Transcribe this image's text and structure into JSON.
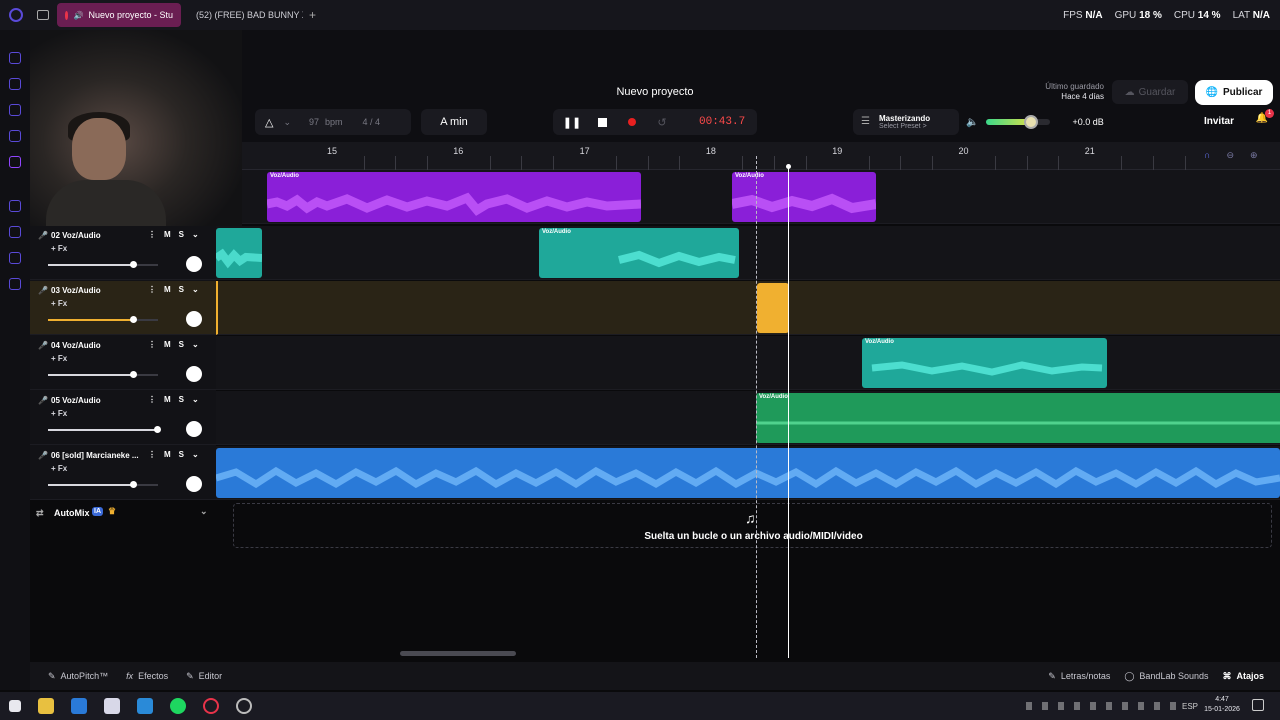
{
  "browser": {
    "tabs": [
      {
        "label": "Nuevo proyecto - Stu",
        "active": true
      },
      {
        "label": "(52) (FREE) BAD BUNNY X",
        "active": false
      }
    ],
    "new_tab": "+",
    "stats": {
      "fps_label": "FPS",
      "fps_value": "N/A",
      "gpu_label": "GPU",
      "gpu_value": "18 %",
      "cpu_label": "CPU",
      "cpu_value": "14 %",
      "lat_label": "LAT",
      "lat_value": "N/A"
    },
    "extension_hint": "dio",
    "ai_label": "AI"
  },
  "header": {
    "project_title": "Nuevo proyecto",
    "bpm": "97",
    "bpm_unit": "bpm",
    "time_signature": "4 / 4",
    "key": "A min",
    "time_display": "00:43.7",
    "master_title": "Masterizando",
    "master_preset": "Select Preset >",
    "volume_db": "+0.0 dB",
    "volume_level": 0.7,
    "last_saved_label": "Último guardado",
    "last_saved_value": "Hace 4 días",
    "save_label": "Guardar",
    "publish_label": "Publicar",
    "invite_label": "Invitar",
    "notification_count": "1"
  },
  "ruler": {
    "bars": [
      "15",
      "16",
      "17",
      "18",
      "19",
      "20",
      "21"
    ]
  },
  "tracks": [
    {
      "name": "02 Voz/Audio",
      "fx": "+ Fx",
      "mute": "M",
      "solo": "S",
      "fader": 0.78
    },
    {
      "name": "03 Voz/Audio",
      "fx": "+ Fx",
      "mute": "M",
      "solo": "S",
      "fader": 0.78
    },
    {
      "name": "04 Voz/Audio",
      "fx": "+ Fx",
      "mute": "M",
      "solo": "S",
      "fader": 0.78
    },
    {
      "name": "05 Voz/Audio",
      "fx": "+ Fx",
      "mute": "M",
      "solo": "S",
      "fader": 1.0
    },
    {
      "name": "06 [sold] Marcianeke ...",
      "fx": "+ Fx",
      "mute": "M",
      "solo": "S",
      "fader": 0.78
    }
  ],
  "clips": {
    "track1": [
      {
        "label": "Voz/Audio"
      },
      {
        "label": "Voz/Audio"
      }
    ],
    "track2": [
      {
        "label": "Voz/Audio"
      }
    ],
    "track4": [
      {
        "label": "Voz/Audio"
      }
    ],
    "track5": [
      {
        "label": "Voz/Audio"
      }
    ]
  },
  "automix": {
    "label": "AutoMix",
    "badge": "IA"
  },
  "dropzone": {
    "text": "Suelta un bucle o un archivo audio/MIDI/video"
  },
  "bottom_bar": {
    "autopitch": "AutoPitch™",
    "effects": "Efectos",
    "editor": "Editor",
    "lyrics": "Letras/notas",
    "sounds": "BandLab Sounds",
    "shortcuts": "Atajos"
  },
  "taskbar": {
    "lang": "ESP",
    "time": "4:47",
    "date": "15-01-2026"
  },
  "colors": {
    "purple": "#8a1fd8",
    "teal": "#1fa89a",
    "orange": "#f0b030",
    "green": "#1f9a5a",
    "blue": "#2a7ad8",
    "accent": "#5a4ad8",
    "time_red": "#ff4a4a"
  }
}
